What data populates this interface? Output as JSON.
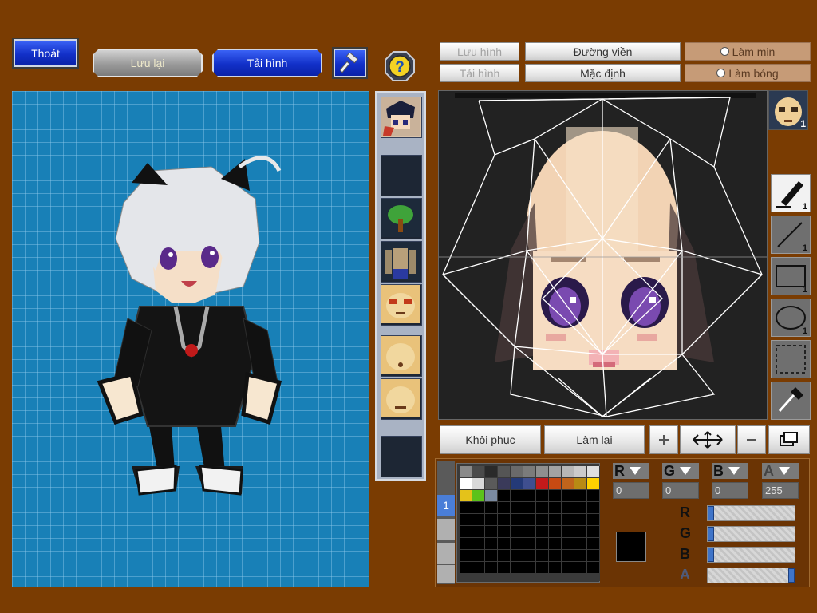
{
  "toolbar": {
    "exit_label": "Thoát",
    "save_label": "Lưu lại",
    "reload_label": "Tải hình"
  },
  "editor_buttons": {
    "save_image": "Lưu hình",
    "load_image": "Tải hình",
    "outline": "Đường viền",
    "default": "Mặc định",
    "smooth": "Làm mịn",
    "shine": "Làm bóng",
    "restore": "Khôi phục",
    "redo": "Làm lại"
  },
  "head_badge": "1",
  "tools": [
    {
      "name": "pen",
      "count": "1"
    },
    {
      "name": "line",
      "count": "1"
    },
    {
      "name": "rectangle",
      "count": "1"
    },
    {
      "name": "ellipse",
      "count": "1"
    },
    {
      "name": "select",
      "count": ""
    },
    {
      "name": "eyedropper",
      "count": ""
    }
  ],
  "palette": {
    "colors_row1": [
      "#8a8a8a",
      "#4a4a4a",
      "#2a2a2a",
      "#555555",
      "#6a6a6a",
      "#7b7b7b",
      "#8f8f8f",
      "#a3a3a3",
      "#b7b7b7",
      "#cbcbcb",
      "#dfdfdf"
    ],
    "colors_row2": [
      "#ffffff",
      "#d9d9d9",
      "#5a5a5a",
      "#3a3a5a",
      "#243a78",
      "#3f4f8f",
      "#c41a1a",
      "#c84a12",
      "#c0641c",
      "#b88a14",
      "#ffd200"
    ],
    "colors_row3": [
      "#e4c21a",
      "#5cc21a",
      "#7a8aa0"
    ]
  },
  "color": {
    "r_value": "0",
    "g_value": "0",
    "b_value": "0",
    "a_value": "255",
    "r": 0,
    "g": 0,
    "b": 0,
    "a": 255,
    "current": "#000000"
  }
}
